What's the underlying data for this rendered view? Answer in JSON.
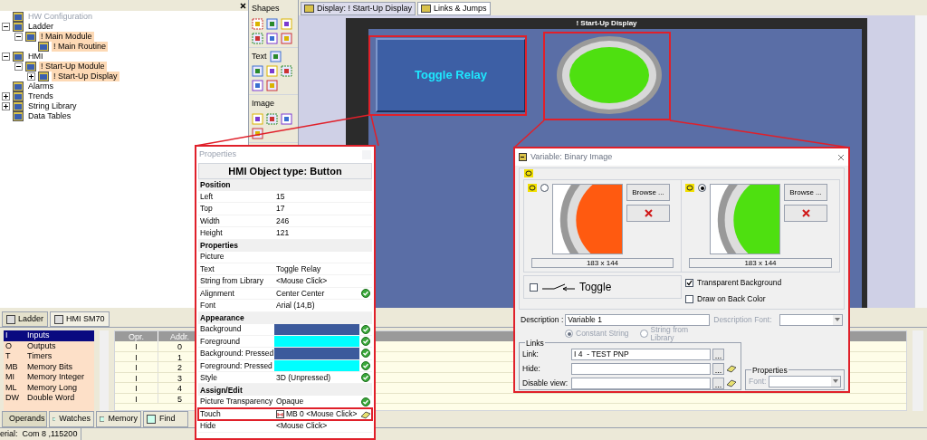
{
  "tree": [
    {
      "label": "HW Configuration",
      "disabled": true,
      "highlighted": false
    },
    {
      "label": "Ladder",
      "disabled": false,
      "highlighted": false,
      "expanded": true,
      "children": [
        {
          "label": "! Main Module",
          "disabled": false,
          "highlighted": true,
          "expanded": true,
          "children": [
            {
              "label": "! Main Routine",
              "disabled": false,
              "highlighted": true
            }
          ]
        }
      ]
    },
    {
      "label": "HMI",
      "disabled": false,
      "highlighted": false,
      "expanded": true,
      "children": [
        {
          "label": "! Start-Up Module",
          "disabled": false,
          "highlighted": true,
          "expanded": true,
          "children": [
            {
              "label": "! Start-Up Display",
              "disabled": false,
              "highlighted": true,
              "expanded": false
            }
          ]
        }
      ]
    },
    {
      "label": "Alarms",
      "disabled": false,
      "highlighted": false
    },
    {
      "label": "Trends",
      "disabled": false,
      "highlighted": false,
      "expanded": false
    },
    {
      "label": "String Library",
      "disabled": false,
      "highlighted": false,
      "expanded": false
    },
    {
      "label": "Data Tables",
      "disabled": false,
      "highlighted": false
    }
  ],
  "toolbox": {
    "sections": [
      {
        "title": "Shapes"
      },
      {
        "title": "Text"
      },
      {
        "title": "Image"
      }
    ]
  },
  "tabs": [
    {
      "label": "Display: ! Start-Up Display",
      "selected": true
    },
    {
      "label": "Links & Jumps",
      "selected": false
    }
  ],
  "display": {
    "title": "! Start-Up Display",
    "button_text": "Toggle Relay"
  },
  "properties": {
    "title": "Properties",
    "heading": "HMI Object type: Button",
    "groups": [
      {
        "name": "Position",
        "rows": [
          {
            "label": "Left",
            "value": "15",
            "kind": "text",
            "ok": false,
            "outlined": false
          },
          {
            "label": "Top",
            "value": "17",
            "kind": "text",
            "ok": false,
            "outlined": false
          },
          {
            "label": "Width",
            "value": "246",
            "kind": "text",
            "ok": false,
            "outlined": false
          },
          {
            "label": "Height",
            "value": "121",
            "kind": "text",
            "ok": false,
            "outlined": false
          }
        ]
      },
      {
        "name": "Properties",
        "rows": [
          {
            "label": "Picture",
            "value": "",
            "kind": "text",
            "ok": false,
            "outlined": false
          },
          {
            "label": "Text",
            "value": "Toggle Relay",
            "kind": "text",
            "ok": false,
            "outlined": false
          },
          {
            "label": "String from Library",
            "value": "<Mouse Click>",
            "kind": "text",
            "ok": false,
            "outlined": false
          },
          {
            "label": "Alignment",
            "value": "Center Center",
            "kind": "text",
            "ok": true,
            "outlined": false
          },
          {
            "label": "Font",
            "value": "Arial (14,B)",
            "kind": "text",
            "ok": false,
            "outlined": false
          }
        ]
      },
      {
        "name": "Appearance",
        "rows": [
          {
            "label": "Background",
            "kind": "swatch",
            "color": "#3c5a9c",
            "ok": true,
            "outlined": false
          },
          {
            "label": "Foreground",
            "kind": "swatch",
            "color": "#00ffff",
            "ok": true,
            "outlined": false
          },
          {
            "label": "Background: Pressed",
            "kind": "swatch",
            "color": "#3c5a9c",
            "ok": true,
            "outlined": false
          },
          {
            "label": "Foreground: Pressed",
            "kind": "swatch",
            "color": "#00ffff",
            "ok": true,
            "outlined": false
          },
          {
            "label": "Style",
            "value": "3D (Unpressed)",
            "kind": "text",
            "ok": true,
            "outlined": false
          }
        ]
      },
      {
        "name": "Assign/Edit",
        "rows": [
          {
            "label": "Picture Transparency",
            "value": "Opaque",
            "kind": "text",
            "ok": true,
            "outlined": false
          },
          {
            "label": "Touch",
            "value": "MB 0 <Mouse Click>",
            "kind": "link",
            "ok": false,
            "outlined": true
          },
          {
            "label": "Hide",
            "value": "<Mouse Click>",
            "kind": "text",
            "ok": false,
            "outlined": false
          }
        ]
      }
    ]
  },
  "dialog": {
    "title": "Variable: Binary Image",
    "images": [
      {
        "size": "183 x 144",
        "selected": false,
        "color": "#ff5a10",
        "browse": "Browse ..."
      },
      {
        "size": "183 x 144",
        "selected": true,
        "color": "#4ee010",
        "browse": "Browse ..."
      }
    ],
    "toggle": {
      "label": "Toggle",
      "checked": false
    },
    "options": [
      {
        "label": "Transparent Background",
        "checked": true
      },
      {
        "label": "Draw on Back Color",
        "checked": false
      }
    ],
    "description_label": "Description :",
    "description": "Variable 1",
    "description_font_label": "Description Font:",
    "string_sources": [
      {
        "label": "Constant String",
        "selected": true
      },
      {
        "label": "String from Library",
        "selected": false
      }
    ],
    "links": {
      "title": "Links",
      "rows": [
        {
          "label": "Link:",
          "value": "I 4  - TEST PNP",
          "eraser": false
        },
        {
          "label": "Hide:",
          "value": "",
          "eraser": true
        },
        {
          "label": "Disable view:",
          "value": "",
          "eraser": true
        }
      ]
    },
    "properties_group": {
      "title": "Properties",
      "font_label": "Font:"
    }
  },
  "view_tabs": [
    {
      "label": "Ladder",
      "selected": true
    },
    {
      "label": "HMI SM70",
      "selected": false
    }
  ],
  "operands": [
    {
      "code": "I",
      "name": "Inputs",
      "selected": true
    },
    {
      "code": "O",
      "name": "Outputs",
      "selected": false
    },
    {
      "code": "T",
      "name": "Timers",
      "selected": false
    },
    {
      "code": "MB",
      "name": "Memory Bits",
      "selected": false
    },
    {
      "code": "MI",
      "name": "Memory Integer",
      "selected": false
    },
    {
      "code": "ML",
      "name": "Memory Long",
      "selected": false
    },
    {
      "code": "DW",
      "name": "Double Word",
      "selected": false
    }
  ],
  "address_table": {
    "columns": [
      "Opr.",
      "Addr."
    ],
    "rows": [
      [
        "I",
        "0"
      ],
      [
        "I",
        "1"
      ],
      [
        "I",
        "2"
      ],
      [
        "I",
        "3"
      ],
      [
        "I",
        "4"
      ],
      [
        "I",
        "5"
      ]
    ]
  },
  "bottom_tabs": [
    {
      "label": "Operands",
      "selected": true
    },
    {
      "label": "Watches",
      "selected": false
    },
    {
      "label": "Memory",
      "selected": false
    },
    {
      "label": "Find",
      "selected": false
    }
  ],
  "status_bar": {
    "port": "erial:  Com 8 ,115200"
  }
}
